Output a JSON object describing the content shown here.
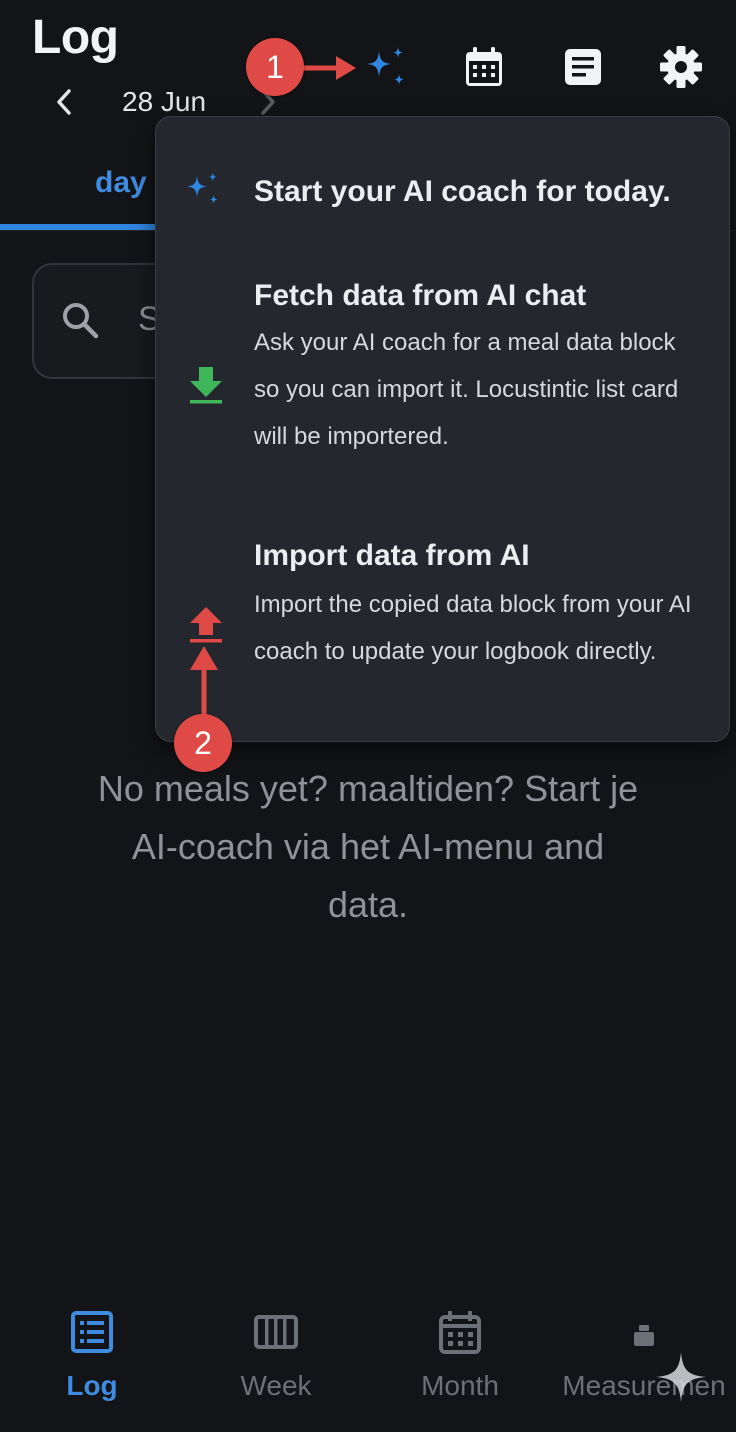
{
  "header": {
    "title": "Log",
    "date": "28 Jun",
    "prev_icon": "chevron-left-icon",
    "next_icon": "chevron-right-icon"
  },
  "toolbar": {
    "ai_icon": "sparkles-icon",
    "calendar_icon": "calendar-icon",
    "notes_icon": "document-icon",
    "settings_icon": "gear-icon"
  },
  "annotations": {
    "badge_1": "1",
    "badge_2": "2",
    "color": "#e04a46"
  },
  "tabs": {
    "active": "day"
  },
  "search": {
    "placeholder": "S"
  },
  "ai_menu": {
    "header": "Start your AI coach for today.",
    "items": [
      {
        "title": "Fetch data from AI chat",
        "description": "Ask your AI coach for a meal data block so you can import it. Locustintic list card will be importered.",
        "icon": "download-icon",
        "icon_color": "#3fb65a"
      },
      {
        "title": "Import data from AI",
        "description": "Import the copied data block from your AI coach to update your logbook directly.",
        "icon": "upload-icon",
        "icon_color": "#e04a46"
      }
    ]
  },
  "empty_state": {
    "line1": "No meals yet?  maaltiden? Start je",
    "line2": "AI-coach via het AI-menu and",
    "line3": "data."
  },
  "bottom_nav": {
    "items": [
      {
        "label": "Log",
        "icon": "list-icon",
        "active": true
      },
      {
        "label": "Week",
        "icon": "week-columns-icon",
        "active": false
      },
      {
        "label": "Month",
        "icon": "calendar-icon",
        "active": false
      },
      {
        "label": "Measuremen",
        "icon": "scale-icon",
        "active": false
      }
    ]
  },
  "colors": {
    "background": "#131417",
    "accent": "#3f8be0",
    "popup": "#24272d",
    "sparkle": "#2f86e0"
  }
}
